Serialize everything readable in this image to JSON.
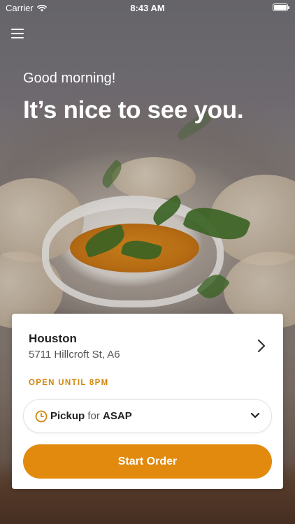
{
  "status_bar": {
    "carrier": "Carrier",
    "time": "8:43 AM",
    "wifi_icon": "wifi-icon",
    "battery_icon": "battery-icon"
  },
  "header": {
    "menu_icon": "hamburger-menu-icon",
    "greeting": "Good morning!",
    "headline": "It’s nice to see you."
  },
  "location": {
    "name": "Houston",
    "address": "5711 Hillcroft St, A6",
    "hours": "OPEN UNTIL 8PM",
    "chevron_icon": "chevron-right-icon"
  },
  "order_type": {
    "mode": "Pickup",
    "connector": "for",
    "time": "ASAP",
    "clock_icon": "clock-icon",
    "dropdown_icon": "chevron-down-icon"
  },
  "start_button": {
    "label": "Start Order"
  },
  "colors": {
    "accent": "#E18A0E",
    "hours_text": "#D2860C",
    "card_bg": "#FFFFFF",
    "text_dark": "#222222"
  }
}
